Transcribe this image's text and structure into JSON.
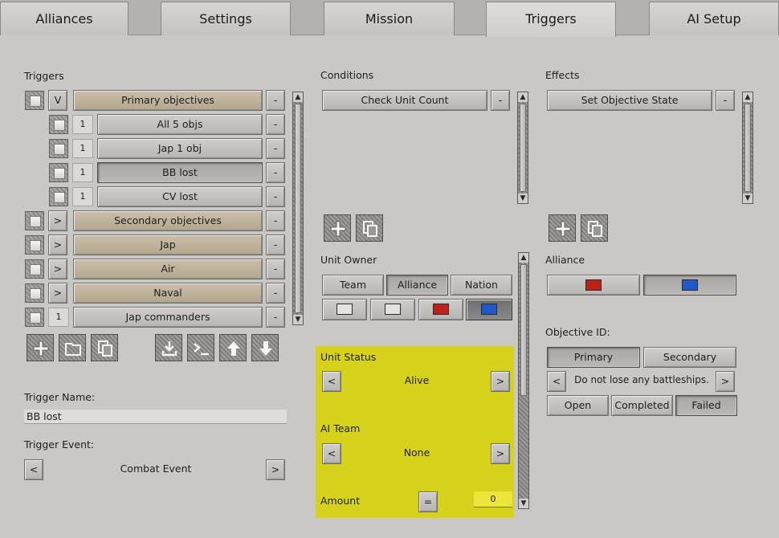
{
  "tabs": [
    "Alliances",
    "Settings",
    "Mission",
    "Triggers",
    "AI Setup"
  ],
  "triggers": {
    "section_label": "Triggers",
    "rows": [
      {
        "toggle": "V",
        "label": "Primary objectives",
        "level": 0,
        "style": "tan"
      },
      {
        "toggle": "1",
        "label": "All 5 objs",
        "level": 1,
        "style": "gray"
      },
      {
        "toggle": "1",
        "label": "Jap 1 obj",
        "level": 1,
        "style": "gray"
      },
      {
        "toggle": "1",
        "label": "BB lost",
        "level": 1,
        "style": "selected"
      },
      {
        "toggle": "1",
        "label": "CV lost",
        "level": 1,
        "style": "gray"
      },
      {
        "toggle": ">",
        "label": "Secondary objectives",
        "level": 0,
        "style": "tan"
      },
      {
        "toggle": ">",
        "label": "Jap",
        "level": 0,
        "style": "tan"
      },
      {
        "toggle": ">",
        "label": "Air",
        "level": 0,
        "style": "tan"
      },
      {
        "toggle": ">",
        "label": "Naval",
        "level": 0,
        "style": "tan"
      },
      {
        "toggle": "1",
        "label": "Jap commanders",
        "level": 0,
        "style": "gray"
      }
    ],
    "remove_label": "-",
    "name_label": "Trigger Name:",
    "name_value": "BB lost",
    "event_label": "Trigger Event:",
    "event_value": "Combat Event",
    "prev": "<",
    "next": ">"
  },
  "conditions": {
    "section_label": "Conditions",
    "items": [
      "Check Unit Count"
    ],
    "remove_label": "-"
  },
  "effects": {
    "section_label": "Effects",
    "items": [
      "Set Objective State"
    ],
    "remove_label": "-"
  },
  "unit_owner": {
    "label": "Unit Owner",
    "options": [
      "Team",
      "Alliance",
      "Nation"
    ],
    "selected": "Alliance",
    "colors": [
      "#e2e2e0",
      "#e2e2e0",
      "#c0201a",
      "#1f58c8"
    ]
  },
  "unit_status": {
    "label": "Unit Status",
    "value": "Alive",
    "prev": "<",
    "next": ">"
  },
  "ai_team": {
    "label": "AI Team",
    "value": "None",
    "prev": "<",
    "next": ">"
  },
  "amount": {
    "label": "Amount",
    "operator": "=",
    "value": "0"
  },
  "alliance": {
    "label": "Alliance",
    "colors": [
      "#c0201a",
      "#1f58c8"
    ]
  },
  "objective": {
    "label": "Objective ID:",
    "types": [
      "Primary",
      "Secondary"
    ],
    "selected_type": "Primary",
    "prev": "<",
    "next": ">",
    "value": "Do not lose any battleships.",
    "states": [
      "Open",
      "Completed",
      "Failed"
    ],
    "selected_state": "Failed"
  }
}
